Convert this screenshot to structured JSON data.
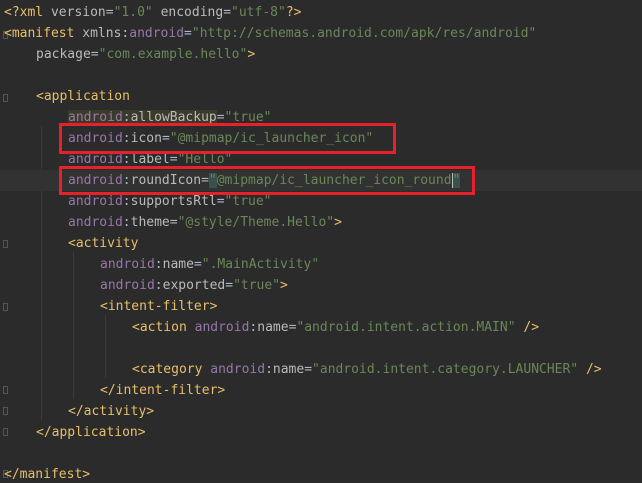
{
  "editor": {
    "language": "xml",
    "file_lines": [
      "<?xml version=\"1.0\" encoding=\"utf-8\"?>",
      "<manifest xmlns:android=\"http://schemas.android.com/apk/res/android\"",
      "package=\"com.example.hello\">",
      "",
      "<application",
      "android:allowBackup=\"true\"",
      "android:icon=\"@mipmap/ic_launcher_icon\"",
      "android:label=\"Hello\"",
      "android:roundIcon=\"@mipmap/ic_launcher_icon_round\"",
      "android:supportsRtl=\"true\"",
      "android:theme=\"@style/Theme.Hello\">",
      "<activity",
      "android:name=\".MainActivity\"",
      "android:exported=\"true\">",
      "<intent-filter>",
      "<action android:name=\"android.intent.action.MAIN\" />",
      "",
      "<category android:name=\"android.intent.category.LAUNCHER\" />",
      "</intent-filter>",
      "</activity>",
      "</application>",
      "",
      "</manifest>"
    ]
  },
  "tokens": {
    "pi_open": "<?",
    "pi_xml": "xml",
    "pi_close": "?>",
    "attr_version": "version",
    "attr_encoding": "encoding",
    "val_version": "\"1.0\"",
    "val_encoding": "\"utf-8\"",
    "manifest_open": "<manifest",
    "manifest_close": "</manifest>",
    "xmlns": "xmlns",
    "android": "android",
    "colon": ":",
    "eq": "=",
    "gt": ">",
    "selfclose": " />",
    "val_schema": "\"http://schemas.android.com/apk/res/android\"",
    "attr_package": "package",
    "val_package": "\"com.example.hello\"",
    "application_open": "<application",
    "application_close": "</application>",
    "attr_allowBackup": "allowBackup",
    "val_true": "\"true\"",
    "attr_icon": "icon",
    "val_icon": "\"@mipmap/ic_launcher_icon\"",
    "attr_label": "label",
    "val_label": "\"Hello\"",
    "attr_roundIcon": "roundIcon",
    "val_roundIcon_q1": "\"",
    "val_roundIcon_body": "@mipmap/ic_launcher_icon_round",
    "val_roundIcon_q2": "\"",
    "attr_supportsRtl": "supportsRtl",
    "attr_theme": "theme",
    "val_theme": "\"@style/Theme.Hello\"",
    "activity_open": "<activity",
    "activity_close": "</activity>",
    "attr_name": "name",
    "val_main_activity": "\".MainActivity\"",
    "attr_exported": "exported",
    "intent_open": "<intent-filter",
    "intent_close": "</intent-filter",
    "action_open": "<action",
    "val_action": "\"android.intent.action.MAIN\"",
    "category_open": "<category",
    "val_category": "\"android.intent.category.LAUNCHER\""
  },
  "highlights": {
    "color": "#e8202a",
    "boxes": [
      "icon-attribute-line",
      "roundIcon-attribute-line"
    ]
  }
}
